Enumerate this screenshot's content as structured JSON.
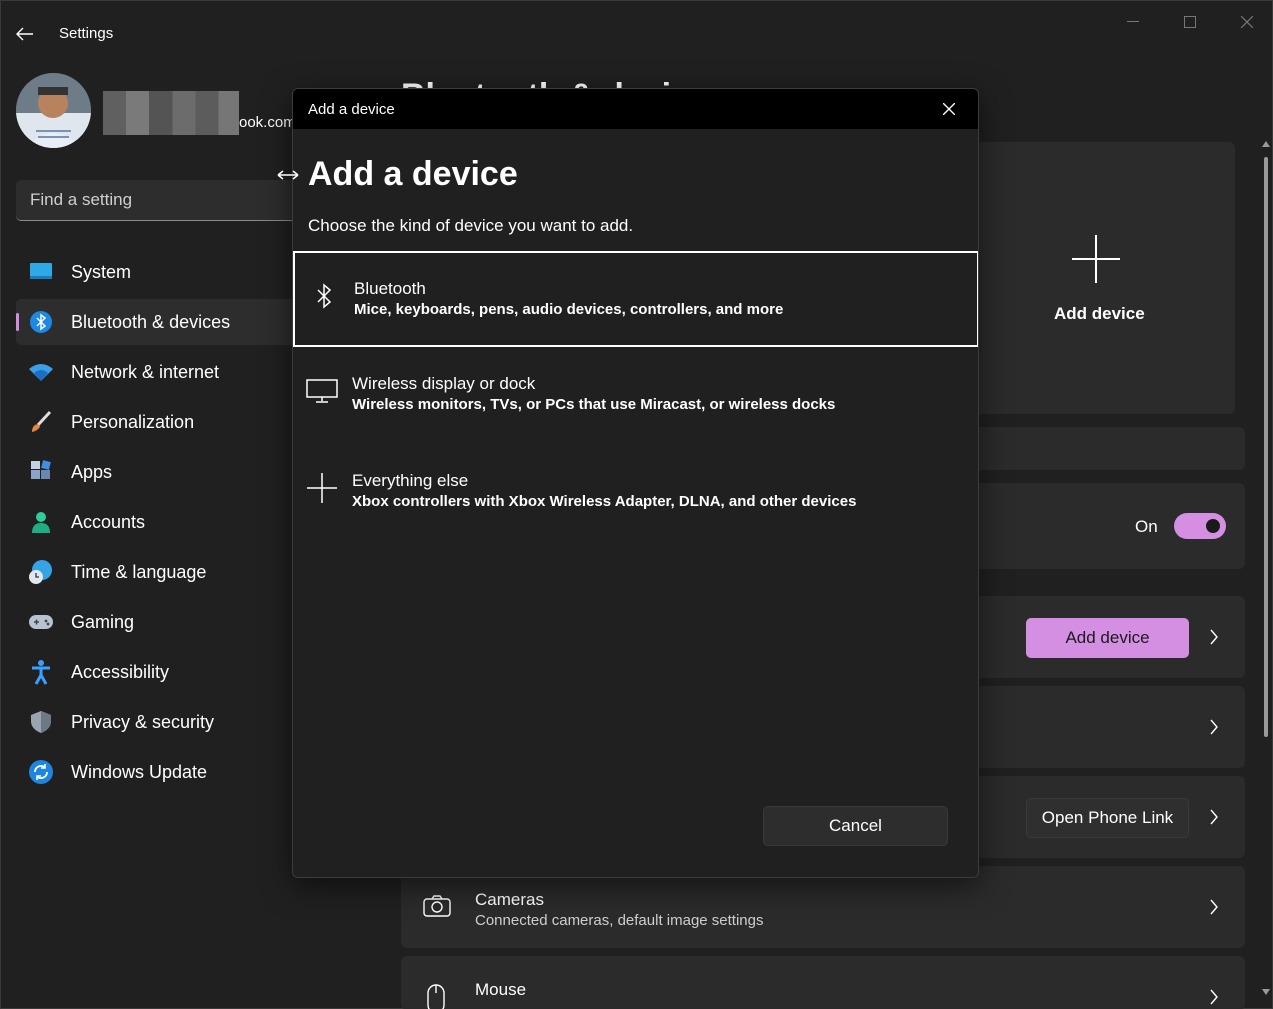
{
  "app": {
    "title": "Settings"
  },
  "account": {
    "email_suffix": "ook.com"
  },
  "search": {
    "placeholder": "Find a setting"
  },
  "nav": {
    "items": [
      {
        "label": "System",
        "icon": "monitor-icon"
      },
      {
        "label": "Bluetooth & devices",
        "icon": "bluetooth-icon",
        "active": true
      },
      {
        "label": "Network & internet",
        "icon": "wifi-icon"
      },
      {
        "label": "Personalization",
        "icon": "brush-icon"
      },
      {
        "label": "Apps",
        "icon": "apps-icon"
      },
      {
        "label": "Accounts",
        "icon": "person-icon"
      },
      {
        "label": "Time & language",
        "icon": "globe-clock-icon"
      },
      {
        "label": "Gaming",
        "icon": "gamepad-icon"
      },
      {
        "label": "Accessibility",
        "icon": "accessibility-icon"
      },
      {
        "label": "Privacy & security",
        "icon": "shield-icon"
      },
      {
        "label": "Windows Update",
        "icon": "update-icon"
      }
    ]
  },
  "main": {
    "page_title": "Bluetooth & devices",
    "add_device_tile": "Add device",
    "bluetooth_toggle": {
      "label": "On",
      "on": true
    },
    "add_device_button": "Add device",
    "phone_link_button": "Open Phone Link",
    "cameras": {
      "title": "Cameras",
      "subtitle": "Connected cameras, default image settings"
    },
    "mouse": {
      "title": "Mouse"
    }
  },
  "dialog": {
    "window_title": "Add a device",
    "heading": "Add a device",
    "subtitle": "Choose the kind of device you want to add.",
    "options": [
      {
        "title": "Bluetooth",
        "description": "Mice, keyboards, pens, audio devices, controllers, and more",
        "icon": "bluetooth-icon"
      },
      {
        "title": "Wireless display or dock",
        "description": "Wireless monitors, TVs, or PCs that use Miracast, or wireless docks",
        "icon": "monitor-icon"
      },
      {
        "title": "Everything else",
        "description": "Xbox controllers with Xbox Wireless Adapter, DLNA, and other devices",
        "icon": "plus-icon"
      }
    ],
    "cancel_label": "Cancel"
  },
  "colors": {
    "accent": "#d48fe3",
    "background": "#202020",
    "card": "#2b2b2b"
  }
}
